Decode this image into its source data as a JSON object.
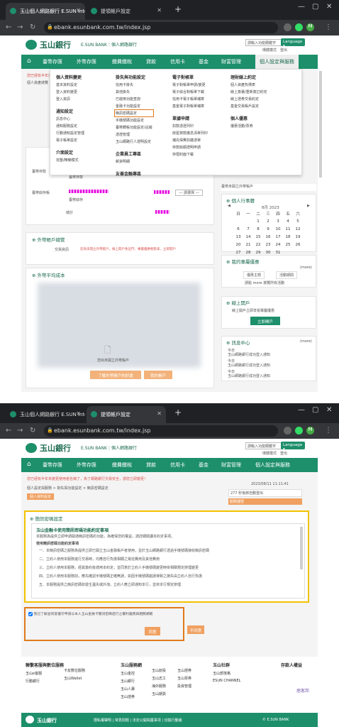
{
  "browser": {
    "tab1": "玉山個人網路銀行 E.SUN Intern",
    "tab2": "提領帳戶設定",
    "url": "ebank.esunbank.com.tw/index.jsp",
    "profile": "M"
  },
  "header": {
    "brand": "玉山銀行",
    "brand_en": "E.SUN BANK",
    "brand_sub": "個人網路銀行",
    "search_placeholder": "請輸入功能關鍵字",
    "language": "Language",
    "links": [
      "環體模式",
      "登出"
    ]
  },
  "nav": {
    "items": [
      "臺幣存匯",
      "外幣存匯",
      "繳費繳稅",
      "貸款",
      "信用卡",
      "基金",
      "財富管理",
      "個人設定與服務"
    ]
  },
  "shot1": {
    "notice": "您已經有半年未變更使用者名稱了，為了網路銀行交易安全，請您立即變更！",
    "breadcrumb": "個人資產總覽",
    "dropdown": {
      "col1": {
        "h1": "個人資料變更",
        "i1": [
          "基本資料設定",
          "登入資料變更",
          "登入資訊"
        ],
        "h2": "通知設定",
        "i2": [
          "訊息中心",
          "通知服務設定",
          "行動通知設定管理",
          "電子帳單設定"
        ],
        "h3": "介面設定",
        "i3": [
          "完整/精簡模式"
        ]
      },
      "col2": {
        "h1": "掛失與功能設定",
        "i1": [
          "信用卡掛失",
          "其他掛失",
          "已啟用功能查詢",
          "金融卡功能設定",
          "簡訊密碼設定",
          "手機號碼功能設定",
          "臺幣轉帳功能設定/註銷",
          "憑證管理",
          "玉山網路行人證明設定"
        ],
        "h2": "企業員工專區",
        "i2": [
          "薪資明細"
        ],
        "h3": "友善金融專區"
      },
      "col3": {
        "h1": "電子對帳單",
        "i1": [
          "電子對帳單申請/變更",
          "電子綜合對帳單下載",
          "信用卡電子帳單補寄",
          "基金電子對帳單補寄"
        ],
        "h2": "單據申請",
        "i2": [
          "扣款憑證列印",
          "房屋貸款繳息清單列印",
          "補充保費扣繳憑單",
          "存款餘額證明申請",
          "存摺封面下載"
        ]
      },
      "col4": {
        "h1": "理財線上約定",
        "i1": [
          "個人資產負債表",
          "線上簽署/重新簽訂約定",
          "線上證券交易約定",
          "基金交易帳戶設定"
        ],
        "h2": "個人優惠",
        "i2": [
          "優惠活動/票券"
        ]
      }
    },
    "account_rows": [
      {
        "type": "臺幣存款",
        "sub": "臺幣存款"
      },
      {
        "type": "臺幣綜存帳",
        "sub": "臺幣綜存"
      }
    ],
    "total": "總計",
    "select": "--- 請選擇 ---",
    "forex_title": "外幣帳戶總覽",
    "forex_label": "交易資訊",
    "forex_warn": "您尚未開立外幣帳戶，線上開戶免出門、專屬優惠輕鬆拿，立即開戶",
    "trend_title": "外幣平均成本",
    "no_account": "您尚未開立外幣帳戶",
    "btn_open": "了解外幣帳戶的好處",
    "btn_go": "我的帳戶",
    "calendar": {
      "title": "個人行事曆",
      "month": "8月 2023",
      "week": [
        "日",
        "一",
        "二",
        "三",
        "四",
        "五",
        "六"
      ],
      "days": [
        [
          "",
          "",
          "1",
          "2",
          "3",
          "4",
          "5"
        ],
        [
          "6",
          "7",
          "8",
          "9",
          "10",
          "11",
          "12"
        ],
        [
          "13",
          "14",
          "15",
          "16",
          "17",
          "18",
          "19"
        ],
        [
          "20",
          "21",
          "22",
          "23",
          "24",
          "25",
          "26"
        ],
        [
          "27",
          "28",
          "29",
          "30",
          "31",
          "",
          ""
        ]
      ]
    },
    "offers": {
      "title": "我的專屬優惠",
      "more": "(more)",
      "tab1": "優惠主題",
      "tab2": "活動期間",
      "empty": "請點 more 瀏覽所有活動"
    },
    "online": {
      "title": "線上開戶",
      "text": "線上開戶立即享受專屬優惠",
      "btn": "立即開戶"
    },
    "msg": {
      "title": "訊息中心",
      "more": "(more)",
      "items": [
        {
          "d": "今日",
          "t": "玉山網路銀行成功登入通知"
        },
        {
          "d": "今日",
          "t": "玉山網路銀行成功登入通知"
        },
        {
          "d": "今日",
          "t": "玉山網路銀行成功登入通知"
        }
      ]
    },
    "side_top": "臺幣未開立外幣帳戶"
  },
  "shot2": {
    "notice": "您已經有半年未變更使用者名稱了，為了網路銀行交易安全，請您立即變更！",
    "crumb": "個人設定與服務 > 掛失與功能設定 > 簡訊密碼設定",
    "bar_btn": "個人資料設定",
    "login_time": "2023/08/11 11:11:41",
    "count": "277",
    "count_label": "秒後將自動登出",
    "quick": "服務捷徑",
    "section_title": "簡訊密碼設定",
    "notice_title": "玉山金融卡使用簡訊密碼功能約定事項",
    "intro": "本服務為提供立即申請開通簡訊密碼的功能，為確保您的權益，請詳細閱讀本約定事項。",
    "subhead": "使用簡訊密碼功能約定事項",
    "terms": [
      "一、本簡訊密碼之服務為提供立即已開立玉山金融帳戶者使用，並於玉山網路銀行透過手機號碼接收簡訊密碼",
      "二、立約人使用本服務進行交易時，均應自行負擔相關之電信費用及其他費用",
      "三、立約人使用本服務，經其簽約後適用本約定，並同意於立約人手機號碼變更時依相關規定辦理變更",
      "四、立約人使用本服務前，應先確認手機號碼正確無誤，如因手機號碼錯誤導致之損失由立約人自行負擔",
      "五、本服務提供之簡訊密碼如發生遺失或外洩，立約人應立即通知本行，並依本行規定辦理"
    ],
    "agree": "我已了解並同意遵守申請以本人玉山金融卡簡訊密碼進行之權利義務與相關規範",
    "btn_ok": "同意",
    "btn_no": "不同意",
    "footer": {
      "cols": [
        {
          "h": "聯繫客服與數位服務",
          "i": [
            "玉山e客服",
            "行動銀行"
          ]
        },
        {
          "h": "",
          "i": [
            "卡友數位服務",
            "玉山Wallet"
          ]
        },
        {
          "h": "玉山服務網",
          "i": [
            "玉山金控",
            "玉山銀行",
            "玉山人壽",
            "玉山證券"
          ]
        },
        {
          "h": "",
          "i": [
            "玉山創投",
            "玉山志工",
            "海外服務",
            "玉山期貨"
          ]
        },
        {
          "h": "",
          "i": [
            "玉山證券",
            "玉山票券",
            "投資管理"
          ]
        },
        {
          "h": "玉山社群",
          "i": [
            "玉山部落格",
            "ESUN CHANNEL"
          ]
        },
        {
          "h": "存款人權益",
          "i": []
        }
      ],
      "bar_links": "隱私權聲明 | 常見問題 | 法定公開揭露事項 | 切換行動版",
      "copyright": "© E.SUN BANK",
      "mark": "痞客邦"
    }
  },
  "colors": {
    "brand_green": "#1d8f6a",
    "orange_highlight": "#e07a1c",
    "yellow_highlight": "#f2c200",
    "notice_red": "#d9534f"
  }
}
